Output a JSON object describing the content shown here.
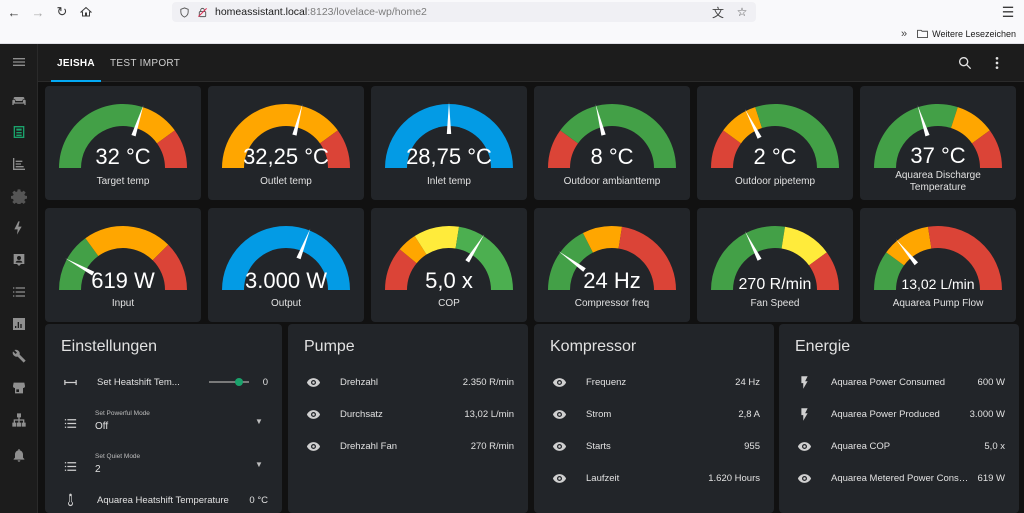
{
  "browser": {
    "url_host": "homeassistant.local",
    "url_path": ":8123/lovelace-wp/home2",
    "bookmarks_label": "Weitere Lesezeichen"
  },
  "tabs": [
    {
      "label": "JEISHA",
      "active": true
    },
    {
      "label": "TEST IMPORT",
      "active": false
    }
  ],
  "colors": {
    "green": "#43a047",
    "orange": "#ffa600",
    "red": "#db4437",
    "blue": "#039be5",
    "yellow": "#ffeb3b",
    "lightgreen": "#4caf50",
    "accent": "#03a9f4"
  },
  "gauges": [
    {
      "value": "32 °C",
      "label": "Target temp",
      "fraction": 0.6,
      "segments": [
        [
          "#43a047",
          0,
          0.6
        ],
        [
          "#ffa600",
          0.6,
          0.8
        ],
        [
          "#db4437",
          0.8,
          1
        ]
      ]
    },
    {
      "value": "32,25 °C",
      "label": "Outlet temp",
      "fraction": 0.58,
      "segments": [
        [
          "#ffa600",
          0,
          0.8
        ],
        [
          "#db4437",
          0.8,
          1
        ]
      ]
    },
    {
      "value": "28,75 °C",
      "label": "Inlet temp",
      "fraction": 0.5,
      "segments": [
        [
          "#039be5",
          0,
          1
        ]
      ]
    },
    {
      "value": "8 °C",
      "label": "Outdoor ambianttemp",
      "fraction": 0.42,
      "segments": [
        [
          "#db4437",
          0,
          0.2
        ],
        [
          "#ffa600",
          0,
          0
        ],
        [
          "#43a047",
          0.2,
          1
        ]
      ]
    },
    {
      "value": "2 °C",
      "label": "Outdoor pipetemp",
      "fraction": 0.35,
      "segments": [
        [
          "#db4437",
          0,
          0.2
        ],
        [
          "#ffa600",
          0.2,
          0.4
        ],
        [
          "#43a047",
          0.4,
          1
        ]
      ]
    },
    {
      "value": "37 °C",
      "label": "Aquarea Discharge Temperature",
      "fraction": 0.4,
      "segments": [
        [
          "#43a047",
          0,
          0.6
        ],
        [
          "#ffa600",
          0.6,
          0.8
        ],
        [
          "#db4437",
          0.8,
          1
        ]
      ]
    },
    {
      "value": "619 W",
      "label": "Input",
      "fraction": 0.16,
      "segments": [
        [
          "#43a047",
          0,
          0.3
        ],
        [
          "#ffa600",
          0.3,
          0.75
        ],
        [
          "#db4437",
          0.75,
          1
        ]
      ]
    },
    {
      "value": "3.000 W",
      "label": "Output",
      "fraction": 0.62,
      "segments": [
        [
          "#039be5",
          0,
          1
        ]
      ]
    },
    {
      "value": "5,0 x",
      "label": "COP",
      "fraction": 0.68,
      "segments": [
        [
          "#db4437",
          0,
          0.22
        ],
        [
          "#ffa600",
          0.22,
          0.32
        ],
        [
          "#ffeb3b",
          0.32,
          0.55
        ],
        [
          "#4caf50",
          0.55,
          1
        ]
      ]
    },
    {
      "value": "24 Hz",
      "label": "Compressor freq",
      "fraction": 0.2,
      "segments": [
        [
          "#43a047",
          0,
          0.35
        ],
        [
          "#ffa600",
          0.35,
          0.55
        ],
        [
          "#db4437",
          0.55,
          1
        ]
      ]
    },
    {
      "value": "270 R/min",
      "label": "Fan Speed",
      "fraction": 0.35,
      "segments": [
        [
          "#43a047",
          0,
          0.55
        ],
        [
          "#ffeb3b",
          0.55,
          0.8
        ],
        [
          "#db4437",
          0.8,
          1
        ]
      ]
    },
    {
      "value": "13,02 L/min",
      "label": "Aquarea Pump Flow",
      "fraction": 0.28,
      "segments": [
        [
          "#43a047",
          0,
          0.2
        ],
        [
          "#ffa600",
          0.2,
          0.45
        ],
        [
          "#db4437",
          0.45,
          1
        ]
      ]
    }
  ],
  "einstellungen": {
    "title": "Einstellungen",
    "heatshift": {
      "name": "Set Heatshift Tem...",
      "value": "0"
    },
    "powerful": {
      "label": "Set Powerful Mode",
      "value": "Off"
    },
    "quiet": {
      "label": "Set Quiet Mode",
      "value": "2"
    },
    "heatshift_temp": {
      "name": "Aquarea Heatshift Temperature",
      "value": "0 °C"
    }
  },
  "pumpe": {
    "title": "Pumpe",
    "rows": [
      {
        "name": "Drehzahl",
        "value": "2.350 R/min"
      },
      {
        "name": "Durchsatz",
        "value": "13,02 L/min"
      },
      {
        "name": "Drehzahl Fan",
        "value": "270 R/min"
      }
    ]
  },
  "kompressor": {
    "title": "Kompressor",
    "rows": [
      {
        "name": "Frequenz",
        "value": "24 Hz"
      },
      {
        "name": "Strom",
        "value": "2,8 A"
      },
      {
        "name": "Starts",
        "value": "955"
      },
      {
        "name": "Laufzeit",
        "value": "1.620 Hours"
      }
    ]
  },
  "energie": {
    "title": "Energie",
    "rows": [
      {
        "name": "Aquarea Power Consumed",
        "value": "600 W",
        "icon": "flash-icon"
      },
      {
        "name": "Aquarea Power Produced",
        "value": "3.000 W",
        "icon": "flash-icon"
      },
      {
        "name": "Aquarea COP",
        "value": "5,0 x",
        "icon": "eye-icon"
      },
      {
        "name": "Aquarea Metered Power Consumption",
        "value": "619 W",
        "icon": "eye-icon"
      }
    ]
  }
}
